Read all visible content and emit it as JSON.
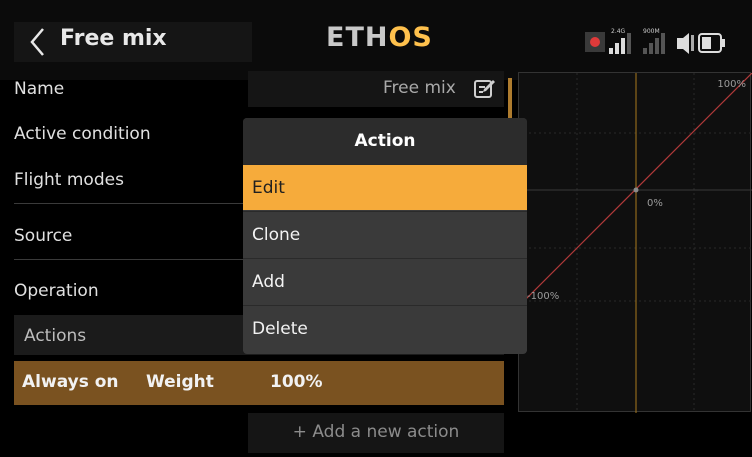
{
  "header": {
    "title": "Free mix",
    "logo_main": "ETH",
    "logo_accent": "OS",
    "signal_24": "2.4G",
    "signal_900": "900M"
  },
  "form": {
    "rows": [
      {
        "label": "Name"
      },
      {
        "label": "Active condition"
      },
      {
        "label": "Flight modes"
      },
      {
        "label": "Source"
      },
      {
        "label": "Operation"
      }
    ],
    "name_value": "Free mix",
    "actions_label": "Actions",
    "action_row": {
      "condition": "Always on",
      "type": "Weight",
      "value": "100%"
    },
    "add_action_label": "+ Add a new action"
  },
  "graph": {
    "label_top": "100%",
    "label_center": "0%",
    "label_bottom": "-100%"
  },
  "popup": {
    "title": "Action",
    "items": [
      "Edit",
      "Clone",
      "Add",
      "Delete"
    ],
    "selected_index": 0
  },
  "colors": {
    "accent": "#f6ab3b",
    "action_row": "#7a5220",
    "curve": "#b03a3a"
  }
}
